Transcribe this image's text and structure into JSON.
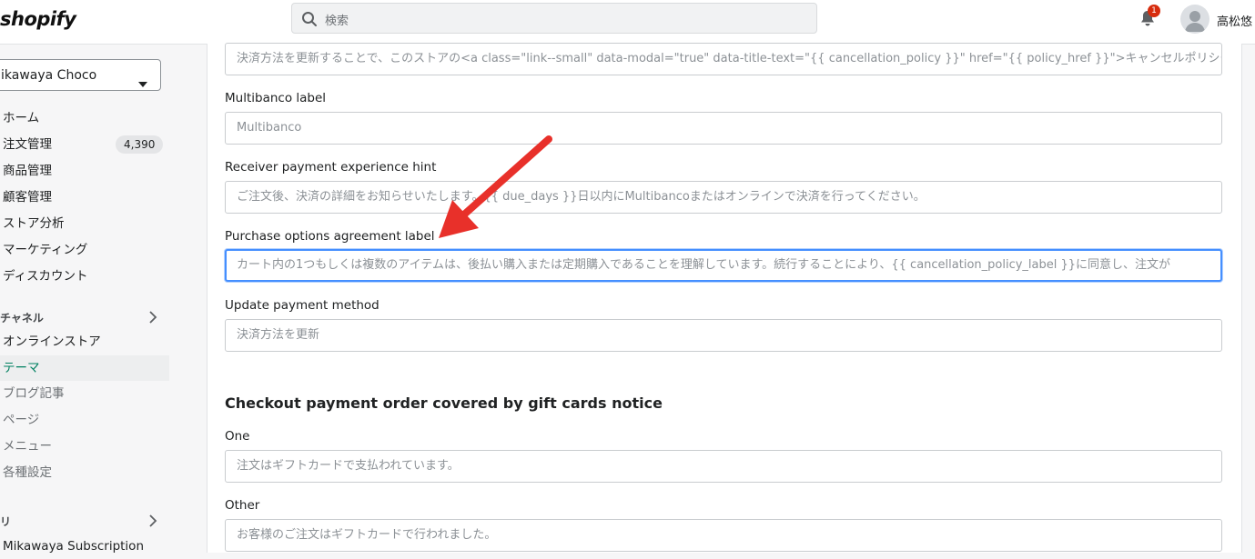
{
  "topbar": {
    "logo": "shopify",
    "search_placeholder": "検索",
    "notification_count": "1",
    "user_name": "高松悠"
  },
  "sidebar": {
    "store_name": "ikawaya Choco",
    "nav": [
      {
        "label": "ホーム"
      },
      {
        "label": "注文管理",
        "count": "4,390"
      },
      {
        "label": "商品管理"
      },
      {
        "label": "顧客管理"
      },
      {
        "label": "ストア分析"
      },
      {
        "label": "マーケティング"
      },
      {
        "label": "ディスカウント"
      }
    ],
    "channels_heading": "チャネル",
    "channel_items": [
      {
        "label": "オンラインストア"
      },
      {
        "label": "テーマ"
      },
      {
        "label": "ブログ記事"
      },
      {
        "label": "ページ"
      },
      {
        "label": "メニュー"
      },
      {
        "label": "各種設定"
      }
    ],
    "apps_heading": "リ",
    "app_item": "Mikawaya Subscription"
  },
  "main": {
    "top_field_value": "決済方法を更新することで、このストアの<a class=\"link--small\" data-modal=\"true\" data-title-text=\"{{ cancellation_policy }}\" href=\"{{ policy_href }}\">キャンセルポリシー",
    "fields": [
      {
        "label": "Multibanco label",
        "placeholder": "Multibanco"
      },
      {
        "label": "Receiver payment experience hint",
        "placeholder": "ご注文後、決済の詳細をお知らせいたします。{{ due_days }}日以内にMultibancoまたはオンラインで決済を行ってください。"
      },
      {
        "label": "Purchase options agreement label",
        "placeholder": "カート内の1つもしくは複数のアイテムは、後払い購入または定期購入であることを理解しています。続行することにより、{{ cancellation_policy_label }}に同意し、注文が"
      },
      {
        "label": "Update payment method",
        "placeholder": "決済方法を更新"
      }
    ],
    "section_title": "Checkout payment order covered by gift cards notice",
    "gift_fields": [
      {
        "label": "One",
        "placeholder": "注文はギフトカードで支払われています。"
      },
      {
        "label": "Other",
        "placeholder": "お客様のご注文はギフトカードで行われました。"
      }
    ]
  },
  "colors": {
    "accent": "#008060",
    "focus": "#458fff",
    "annotation_arrow": "#e8302a",
    "badge": "#d72c0d"
  }
}
